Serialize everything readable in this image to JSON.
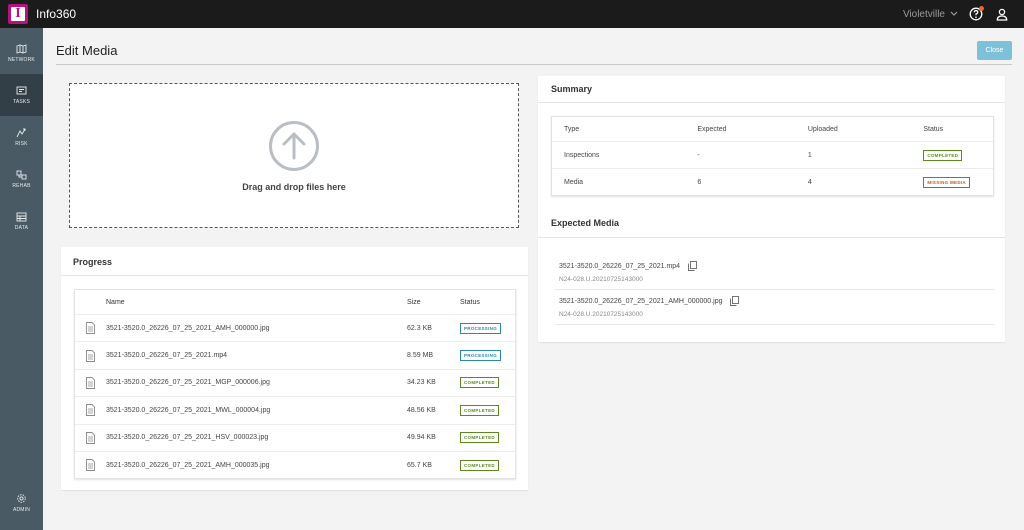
{
  "app": {
    "title": "Info360",
    "logo_letter": "I"
  },
  "topbar": {
    "organization": "Violetville"
  },
  "sidebar": {
    "items": [
      {
        "label": "NETWORK",
        "icon": "map-icon"
      },
      {
        "label": "TASKS",
        "icon": "tasks-icon"
      },
      {
        "label": "RISK",
        "icon": "risk-icon"
      },
      {
        "label": "REHAB",
        "icon": "rehab-icon"
      },
      {
        "label": "DATA",
        "icon": "data-icon"
      }
    ],
    "admin_label": "ADMIN"
  },
  "page": {
    "title": "Edit Media",
    "close_label": "Close"
  },
  "dropzone": {
    "text": "Drag and drop files here"
  },
  "progress": {
    "title": "Progress",
    "columns": {
      "name": "Name",
      "size": "Size",
      "status": "Status"
    },
    "rows": [
      {
        "name": "3521-3520.0_26226_07_25_2021_AMH_000000.jpg",
        "size": "62.3 KB",
        "status": "PROCESSING"
      },
      {
        "name": "3521-3520.0_26226_07_25_2021.mp4",
        "size": "8.59 MB",
        "status": "PROCESSING"
      },
      {
        "name": "3521-3520.0_26226_07_25_2021_MGP_000006.jpg",
        "size": "34.23 KB",
        "status": "COMPLETED"
      },
      {
        "name": "3521-3520.0_26226_07_25_2021_MWL_000004.jpg",
        "size": "48.56 KB",
        "status": "COMPLETED"
      },
      {
        "name": "3521-3520.0_26226_07_25_2021_HSV_000023.jpg",
        "size": "49.94 KB",
        "status": "COMPLETED"
      },
      {
        "name": "3521-3520.0_26226_07_25_2021_AMH_000035.jpg",
        "size": "65.7 KB",
        "status": "COMPLETED"
      }
    ]
  },
  "summary": {
    "title": "Summary",
    "columns": {
      "type": "Type",
      "expected": "Expected",
      "uploaded": "Uploaded",
      "status": "Status"
    },
    "rows": [
      {
        "type": "Inspections",
        "expected": "-",
        "uploaded": "1",
        "status": "COMPLETED"
      },
      {
        "type": "Media",
        "expected": "6",
        "uploaded": "4",
        "status": "MISSING MEDIA"
      }
    ]
  },
  "expected_media": {
    "title": "Expected Media",
    "items": [
      {
        "name": "3521-3520.0_26226_07_25_2021.mp4",
        "id": "N24-028.U.20210725143000"
      },
      {
        "name": "3521-3520.0_26226_07_25_2021_AMH_000000.jpg",
        "id": "N24-028.U.20210725143000"
      }
    ]
  },
  "colors": {
    "topbar": "#1b1b1b",
    "logo": "#b3137a",
    "sidebar": "#4a5a64",
    "sidebar_active": "#333f46",
    "close_button": "#7ec0d9",
    "processing": "#2a89a8",
    "completed": "#5a8a1e",
    "missing_media": "#b85d1c"
  }
}
